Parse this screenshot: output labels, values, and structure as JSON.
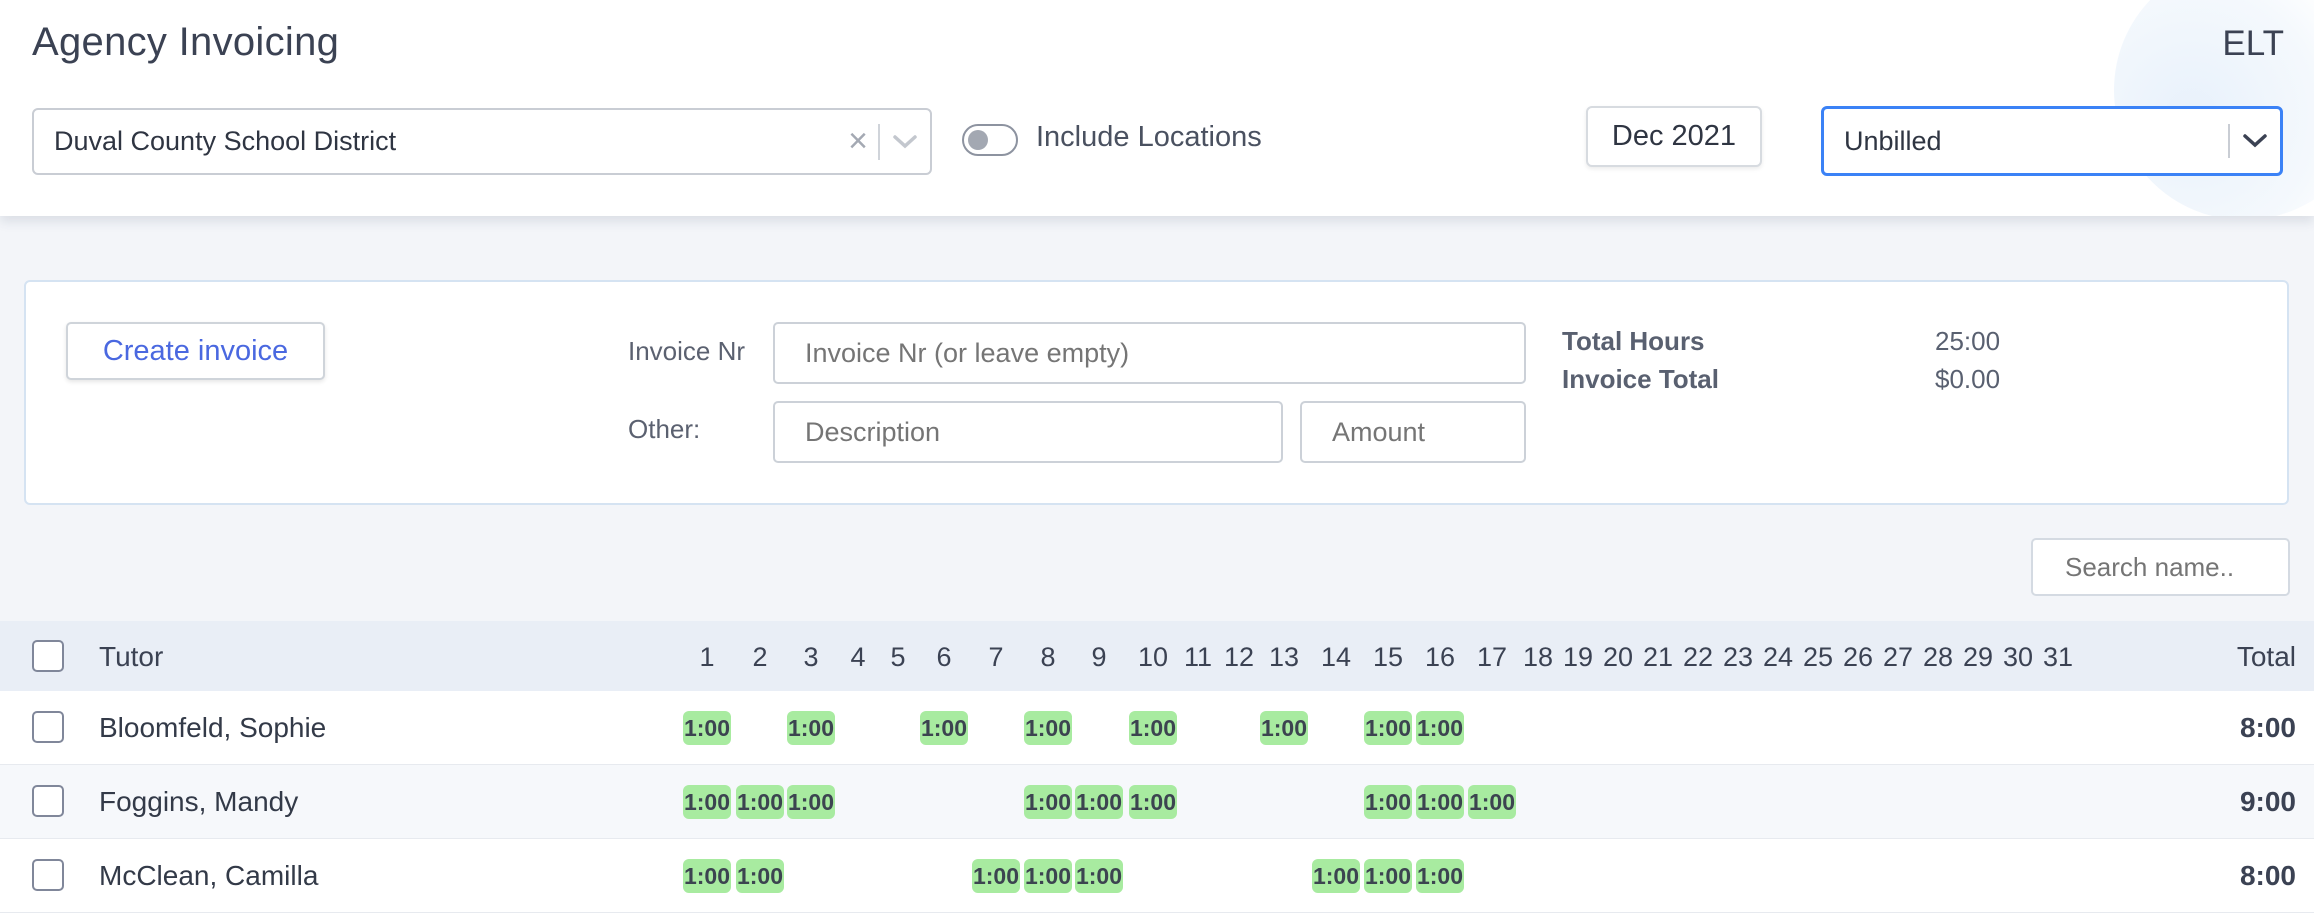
{
  "header": {
    "title": "Agency Invoicing",
    "org_code": "ELT",
    "agency_select": {
      "value": "Duval County School District",
      "clear_icon": "×"
    },
    "include_locations": {
      "label": "Include Locations",
      "checked": false
    },
    "month": "Dec 2021",
    "status_select": {
      "value": "Unbilled"
    }
  },
  "invoice_panel": {
    "create_button": "Create invoice",
    "invoice_nr_label": "Invoice Nr",
    "invoice_nr_placeholder": "Invoice Nr (or leave empty)",
    "other_label": "Other:",
    "description_placeholder": "Description",
    "amount_placeholder": "Amount",
    "total_hours_label": "Total Hours",
    "total_hours_value": "25:00",
    "invoice_total_label": "Invoice Total",
    "invoice_total_value": "$0.00"
  },
  "search": {
    "placeholder": "Search name.."
  },
  "table": {
    "tutor_header": "Tutor",
    "total_header": "Total",
    "days": [
      "1",
      "2",
      "3",
      "4",
      "5",
      "6",
      "7",
      "8",
      "9",
      "10",
      "11",
      "12",
      "13",
      "14",
      "15",
      "16",
      "17",
      "18",
      "19",
      "20",
      "21",
      "22",
      "23",
      "24",
      "25",
      "26",
      "27",
      "28",
      "29",
      "30",
      "31"
    ],
    "rows": [
      {
        "name": "Bloomfeld, Sophie",
        "entries": [
          {
            "day": 1,
            "value": "1:00"
          },
          {
            "day": 3,
            "value": "1:00"
          },
          {
            "day": 6,
            "value": "1:00"
          },
          {
            "day": 8,
            "value": "1:00"
          },
          {
            "day": 10,
            "value": "1:00"
          },
          {
            "day": 13,
            "value": "1:00"
          },
          {
            "day": 15,
            "value": "1:00"
          },
          {
            "day": 16,
            "value": "1:00"
          }
        ],
        "total": "8:00"
      },
      {
        "name": "Foggins, Mandy",
        "entries": [
          {
            "day": 1,
            "value": "1:00"
          },
          {
            "day": 2,
            "value": "1:00"
          },
          {
            "day": 3,
            "value": "1:00"
          },
          {
            "day": 8,
            "value": "1:00"
          },
          {
            "day": 9,
            "value": "1:00"
          },
          {
            "day": 10,
            "value": "1:00"
          },
          {
            "day": 15,
            "value": "1:00"
          },
          {
            "day": 16,
            "value": "1:00"
          },
          {
            "day": 17,
            "value": "1:00"
          }
        ],
        "total": "9:00"
      },
      {
        "name": "McClean, Camilla",
        "entries": [
          {
            "day": 1,
            "value": "1:00"
          },
          {
            "day": 2,
            "value": "1:00"
          },
          {
            "day": 7,
            "value": "1:00"
          },
          {
            "day": 8,
            "value": "1:00"
          },
          {
            "day": 9,
            "value": "1:00"
          },
          {
            "day": 14,
            "value": "1:00"
          },
          {
            "day": 15,
            "value": "1:00"
          },
          {
            "day": 16,
            "value": "1:00"
          }
        ],
        "total": "8:00"
      }
    ]
  },
  "colors": {
    "accent_blue": "#3b82f6",
    "link_blue": "#4a68e0",
    "chip_green": "#a8eba0",
    "header_row_bg": "#e9eef6"
  }
}
